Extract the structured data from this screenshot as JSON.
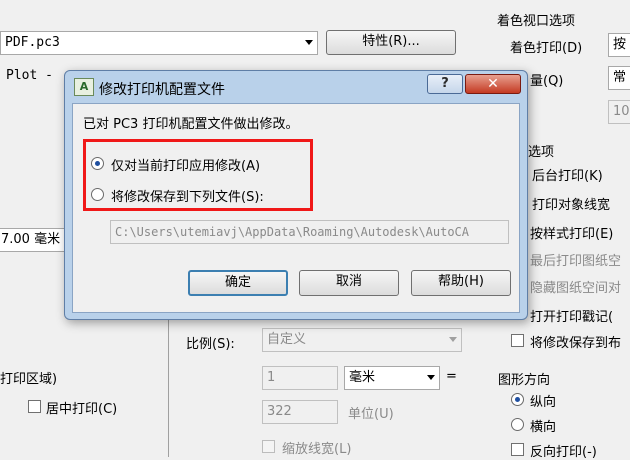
{
  "background": {
    "device_field": "PDF.pc3",
    "properties_button": "特性(R)...",
    "plot_label": "Plot -",
    "paper_width_value": "7.00 毫米",
    "area_label": "打印区域)",
    "center_plot_label": "居中打印(C)",
    "scale_label": "比例(S):",
    "scale_value": "自定义",
    "scale_num": "1",
    "unit_value": "毫米",
    "equals": "=",
    "scale_den": "322",
    "unit_label": "单位(U)",
    "scale_lineweights_label": "缩放线宽(L)",
    "shaded_viewport_header": "着色视口选项",
    "shade_plot_label": "着色打印(D)",
    "shade_plot_value": "按",
    "quality_label": "量(Q)",
    "quality_value": "常",
    "dpi_value": "100",
    "options_header": "选项",
    "opt_background": "后台打印(K)",
    "opt_object_lw": "打印对象线宽",
    "opt_styles": "按样式打印(E)",
    "opt_paperspace_last": "最后打印图纸空",
    "opt_hide_paperspace": "隐藏图纸空间对",
    "opt_stamp": "打开打印戳记(",
    "opt_save_changes": "将修改保存到布",
    "orientation_header": "图形方向",
    "orient_portrait": "纵向",
    "orient_landscape": "横向",
    "orient_upside": "反向打印(-)"
  },
  "dialog": {
    "title": "修改打印机配置文件",
    "app_icon": "autocad-icon",
    "help_glyph": "?",
    "close_glyph": "✕",
    "message": "已对 PC3 打印机配置文件做出修改。",
    "option1": "仅对当前打印应用修改(A)",
    "option2": "将修改保存到下列文件(S):",
    "selected_option": 1,
    "file_path": "C:\\Users\\utemiavj\\AppData\\Roaming\\Autodesk\\AutoCA",
    "ok_label": "确定",
    "cancel_label": "取消",
    "help_label": "帮助(H)",
    "highlight_color": "#f01818"
  }
}
